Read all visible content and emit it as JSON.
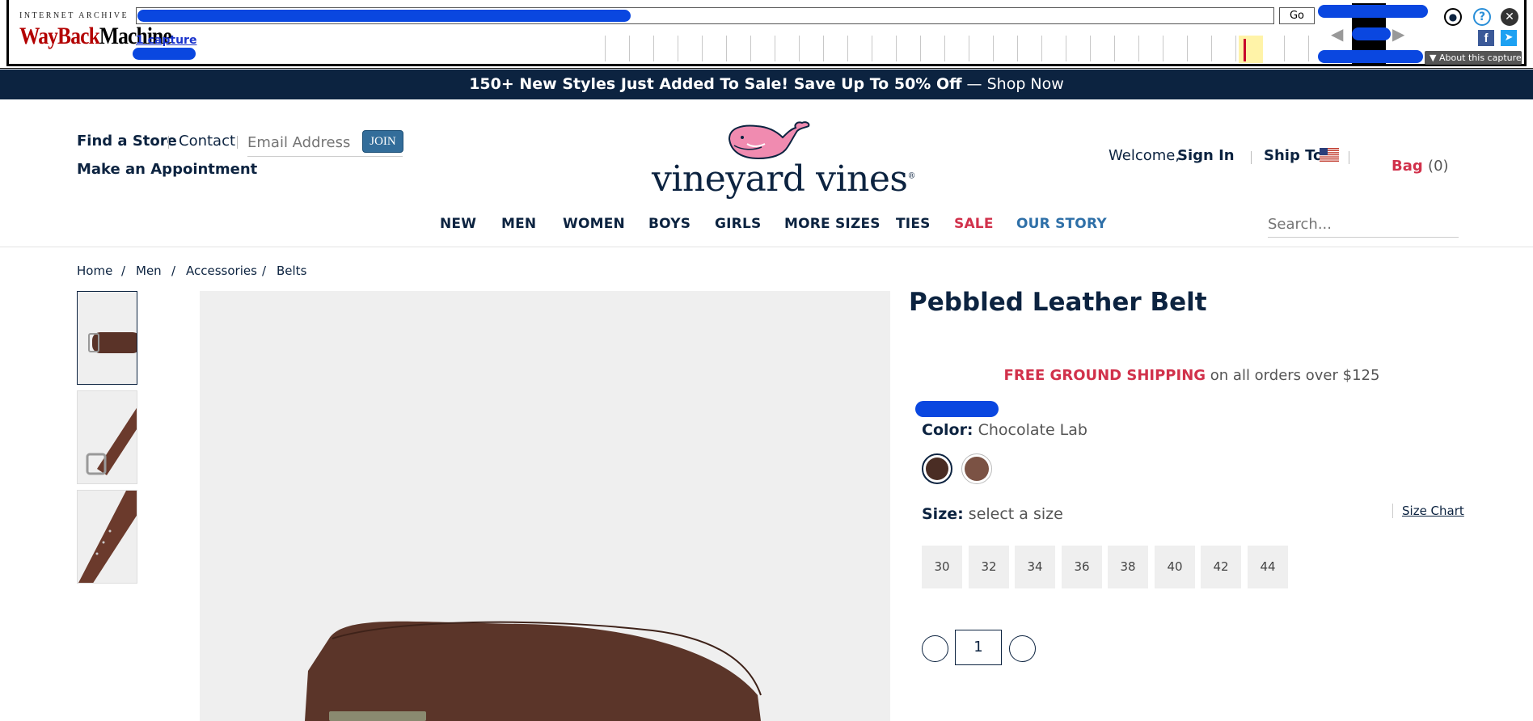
{
  "wayback": {
    "logo_top": "INTERNET ARCHIVE",
    "logo_wayback": "WayBack",
    "logo_machine": "Machine",
    "go_label": "Go",
    "captures_link": "1 capture",
    "about_label": "About this capture",
    "icons": [
      "user-icon",
      "help-icon",
      "close-icon",
      "facebook-icon",
      "twitter-icon"
    ]
  },
  "promo": {
    "bold_text": "150+ New Styles Just Added To Sale! Save Up To 50% Off",
    "dash": " — ",
    "link_text": "Shop Now"
  },
  "header": {
    "find_store": "Find a Store",
    "contact": "Contact",
    "email_placeholder": "Email Address",
    "join_label": "JOIN",
    "appointment": "Make an Appointment",
    "brand": "vineyard vines",
    "brand_mark": "®",
    "welcome": "Welcome,",
    "sign_in": "Sign In",
    "ship_to": "Ship To",
    "bag_label": "Bag",
    "bag_count": "(0)"
  },
  "nav": {
    "items": [
      "NEW",
      "MEN",
      "WOMEN",
      "BOYS",
      "GIRLS",
      "MORE SIZES",
      "TIES",
      "SALE",
      "OUR STORY"
    ],
    "search_placeholder": "Search..."
  },
  "breadcrumb": [
    "Home",
    "Men",
    "Accessories",
    "Belts"
  ],
  "product": {
    "title": "Pebbled Leather Belt",
    "shipping_bold": "FREE GROUND SHIPPING",
    "shipping_rest": " on all orders over $125",
    "color_label": "Color:",
    "color_value": "Chocolate Lab",
    "swatch_colors": [
      "#4a2d24",
      "#7b5244"
    ],
    "size_label": "Size:",
    "size_value": "select a size",
    "size_chart": "Size Chart",
    "sizes": [
      "30",
      "32",
      "34",
      "36",
      "38",
      "40",
      "42",
      "44"
    ],
    "quantity": "1"
  },
  "colors": {
    "navy": "#0c2340",
    "sale_red": "#d1314b",
    "story_blue": "#2f70a8",
    "join_blue": "#336d9a"
  }
}
